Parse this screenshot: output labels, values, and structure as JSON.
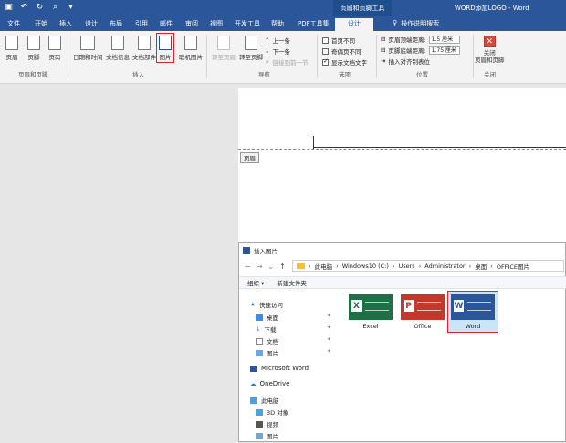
{
  "window": {
    "context_title": "页眉和页脚工具",
    "title": "WORD添加LOGO - Word"
  },
  "tabs": [
    "文件",
    "开始",
    "插入",
    "设计",
    "布局",
    "引用",
    "邮件",
    "审阅",
    "视图",
    "开发工具",
    "帮助",
    "PDF工具集",
    "设计"
  ],
  "tell_me": "操作说明搜索",
  "ribbon": {
    "header_footer": {
      "header": "页眉",
      "footer": "页脚",
      "page_number": "页码",
      "label": "页眉和页脚"
    },
    "insert": {
      "datetime": "日期和时间",
      "docinfo": "文档信息",
      "quickparts": "文档部件",
      "picture": "图片",
      "online_picture": "联机图片",
      "label": "插入"
    },
    "navigation": {
      "goto_header": "转至页眉",
      "goto_footer": "转至页脚",
      "prev": "上一条",
      "next": "下一条",
      "link_prev": "链接到前一节",
      "label": "导航"
    },
    "options": {
      "first_page": "首页不同",
      "odd_even": "奇偶页不同",
      "show_doc_text": "显示文档文字",
      "label": "选项",
      "show_doc_text_checked": true
    },
    "position": {
      "header_top": "页眉顶端距离:",
      "header_top_value": "1.5 厘米",
      "footer_bottom": "页脚底端距离:",
      "footer_bottom_value": "1.75 厘米",
      "align_tab": "插入对齐制表位",
      "label": "位置"
    },
    "close": {
      "label_btn": "关闭\n页眉和页脚",
      "label": "关闭"
    }
  },
  "document": {
    "header_tag": "页眉"
  },
  "dialog": {
    "title": "插入图片",
    "breadcrumb": [
      "此电脑",
      "Windows10 (C:)",
      "Users",
      "Administrator",
      "桌面",
      "OFFICE图片"
    ],
    "organize": "组织 ▾",
    "new_folder": "新建文件夹",
    "nav": {
      "quick_access": "快速访问",
      "items": [
        "桌面",
        "下载",
        "文档",
        "图片"
      ],
      "msword": "Microsoft Word",
      "onedrive": "OneDrive",
      "thispc": "此电脑",
      "pc_items": [
        "3D 对象",
        "视频",
        "图片"
      ]
    },
    "files": [
      {
        "name": "Excel",
        "letter": "X",
        "color": "#1e7145"
      },
      {
        "name": "Office",
        "letter": "P",
        "color": "#c0392b"
      },
      {
        "name": "Word",
        "letter": "W",
        "color": "#2b579a"
      }
    ]
  }
}
